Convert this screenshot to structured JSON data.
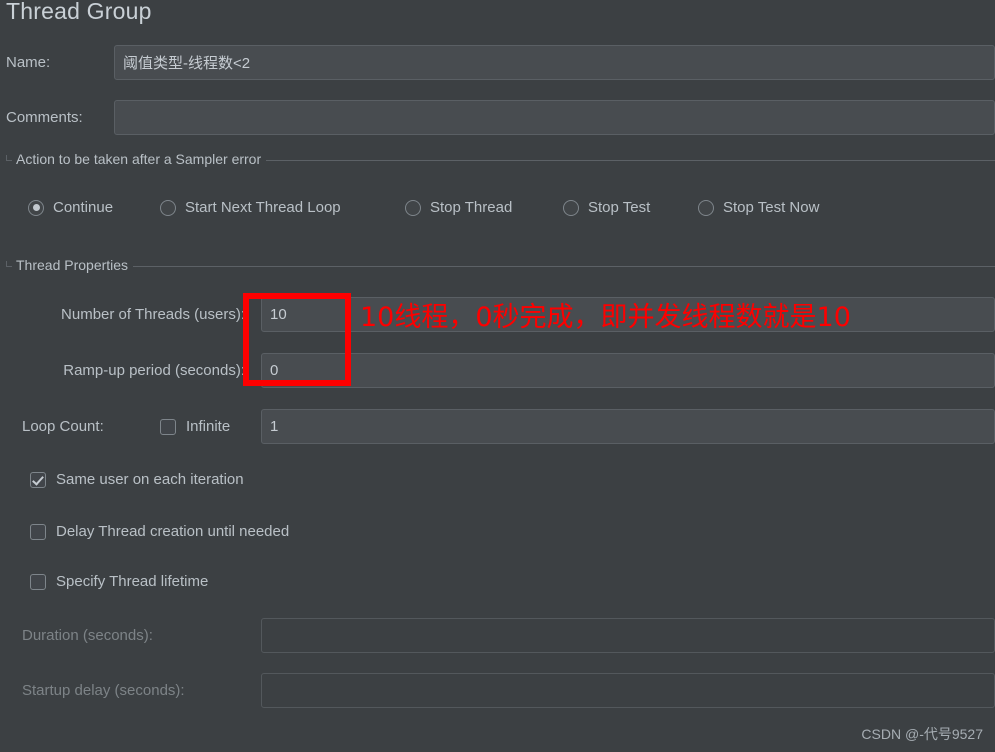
{
  "window": {
    "title": "Thread Group",
    "background_color": "#3c4043",
    "text_color": "#b9c0c6"
  },
  "fields": {
    "name_label": "Name:",
    "name_value": "阈值类型-线程数<2",
    "comments_label": "Comments:",
    "comments_value": ""
  },
  "sampler_error_group": {
    "caption": "Action to be taken after a Sampler error",
    "options": [
      {
        "label": "Continue",
        "selected": true
      },
      {
        "label": "Start Next Thread Loop",
        "selected": false
      },
      {
        "label": "Stop Thread",
        "selected": false
      },
      {
        "label": "Stop Test",
        "selected": false
      },
      {
        "label": "Stop Test Now",
        "selected": false
      }
    ]
  },
  "thread_properties": {
    "caption": "Thread Properties",
    "num_threads_label": "Number of Threads (users):",
    "num_threads_value": "10",
    "ramp_up_label": "Ramp-up period (seconds):",
    "ramp_up_value": "0",
    "loop_count_label": "Loop Count:",
    "infinite_label": "Infinite",
    "infinite_checked": false,
    "loop_count_value": "1",
    "same_user_label": "Same user on each iteration",
    "same_user_checked": true,
    "delay_thread_label": "Delay Thread creation until needed",
    "delay_thread_checked": false,
    "specify_lifetime_label": "Specify Thread lifetime",
    "specify_lifetime_checked": false,
    "duration_label": "Duration (seconds):",
    "duration_value": "",
    "startup_delay_label": "Startup delay (seconds):",
    "startup_delay_value": ""
  },
  "annotation": {
    "color": "#fe0000",
    "text": "10线程，0秒完成，即并发线程数就是10"
  },
  "watermark": {
    "text": "CSDN @-代号9527"
  }
}
